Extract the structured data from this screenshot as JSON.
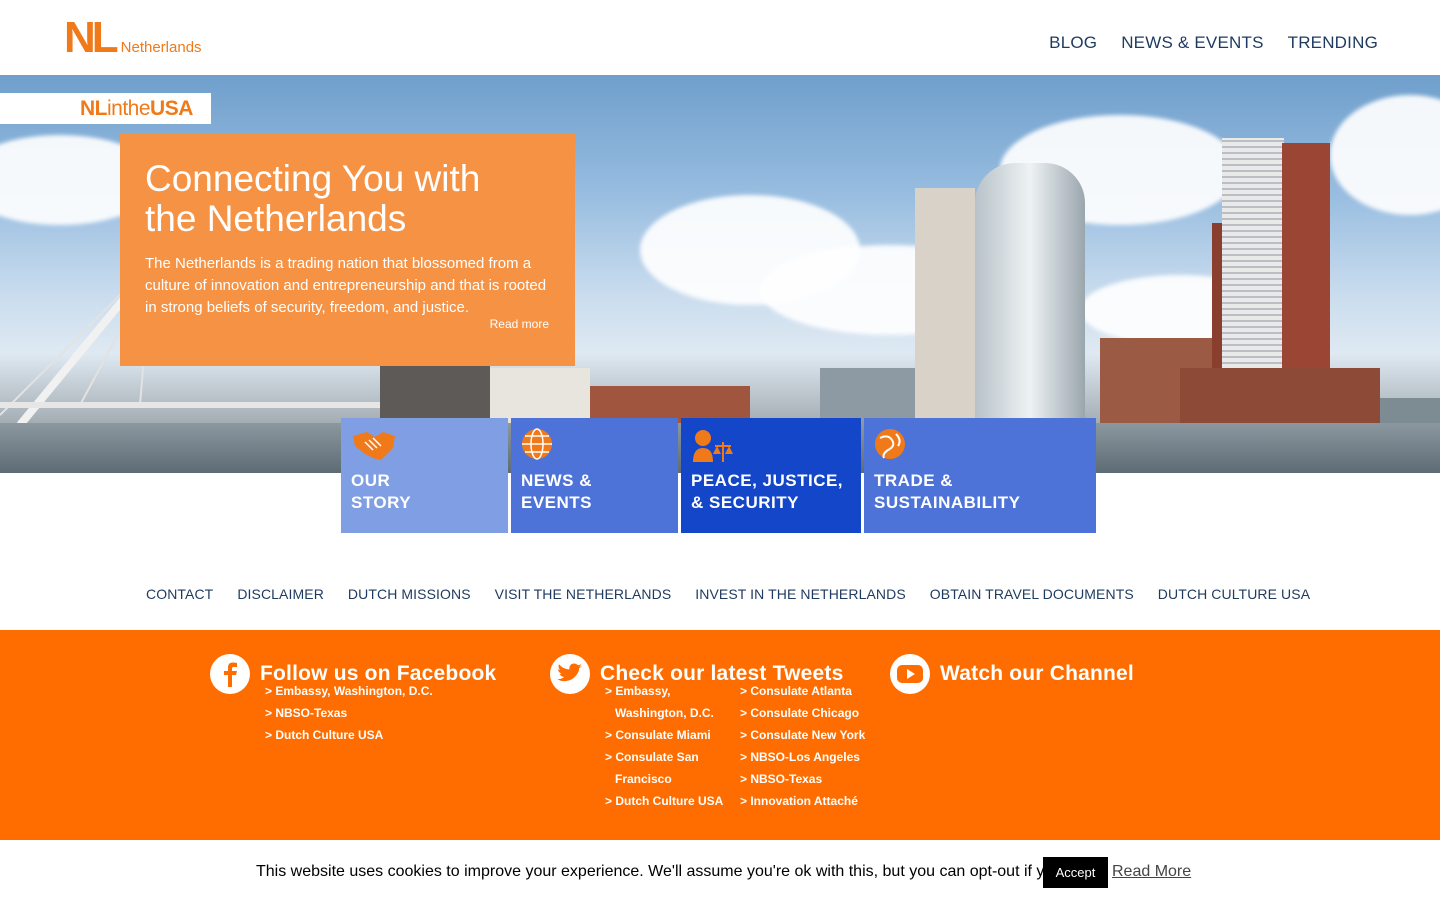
{
  "header": {
    "logo_mark": "NL",
    "logo_text": "Netherlands",
    "nav": [
      "BLOG",
      "NEWS & EVENTS",
      "TRENDING"
    ]
  },
  "hero": {
    "badge_bold": "NL",
    "badge_mid": "inthe",
    "badge_end": "USA",
    "title": "Connecting You with the Netherlands",
    "body": "The Netherlands is a trading nation that blossomed from a culture of innovation and entrepreneurship and that is rooted in strong beliefs of security, freedom, and justice.",
    "read_more": "Read more"
  },
  "tiles": [
    {
      "label": "OUR\nSTORY",
      "icon": "handshake-icon",
      "color": "#7f9ee3"
    },
    {
      "label": "NEWS &\nEVENTS",
      "icon": "globe-icon",
      "color": "#4e73d8"
    },
    {
      "label": "PEACE, JUSTICE,\n& SECURITY",
      "icon": "justice-icon",
      "color": "#1446c9"
    },
    {
      "label": "TRADE &\nSUSTAINABILITY",
      "icon": "trade-globe-icon",
      "color": "#4e73d8"
    }
  ],
  "footer_links": [
    "CONTACT",
    "DISCLAIMER",
    "DUTCH MISSIONS",
    "VISIT THE NETHERLANDS",
    "INVEST IN THE NETHERLANDS",
    "OBTAIN TRAVEL DOCUMENTS",
    "DUTCH CULTURE USA"
  ],
  "social": {
    "facebook": {
      "title": "Follow us on Facebook",
      "links": [
        "> Embassy, Washington, D.C.",
        "> NBSO-Texas",
        "> Dutch Culture USA"
      ]
    },
    "twitter": {
      "title": "Check our latest Tweets",
      "col1": [
        "> Embassy,",
        "Washington, D.C.",
        "> Consulate Miami",
        "> Consulate San",
        "Francisco",
        "> Dutch Culture USA"
      ],
      "col2": [
        "> Consulate Atlanta",
        "> Consulate Chicago",
        "> Consulate New York",
        "> NBSO-Los Angeles",
        "> NBSO-Texas",
        "> Innovation Attaché"
      ]
    },
    "youtube": {
      "title": "Watch our Channel"
    }
  },
  "cookie": {
    "text": "This website uses cookies to improve your experience. We'll assume you're ok with this, but you can opt-out if you wish.",
    "accept": "Accept",
    "read_more": "Read More"
  },
  "colors": {
    "brand_orange": "#ff6d00",
    "intro_orange": "#f59244",
    "nav_text": "#1e3a5f"
  }
}
